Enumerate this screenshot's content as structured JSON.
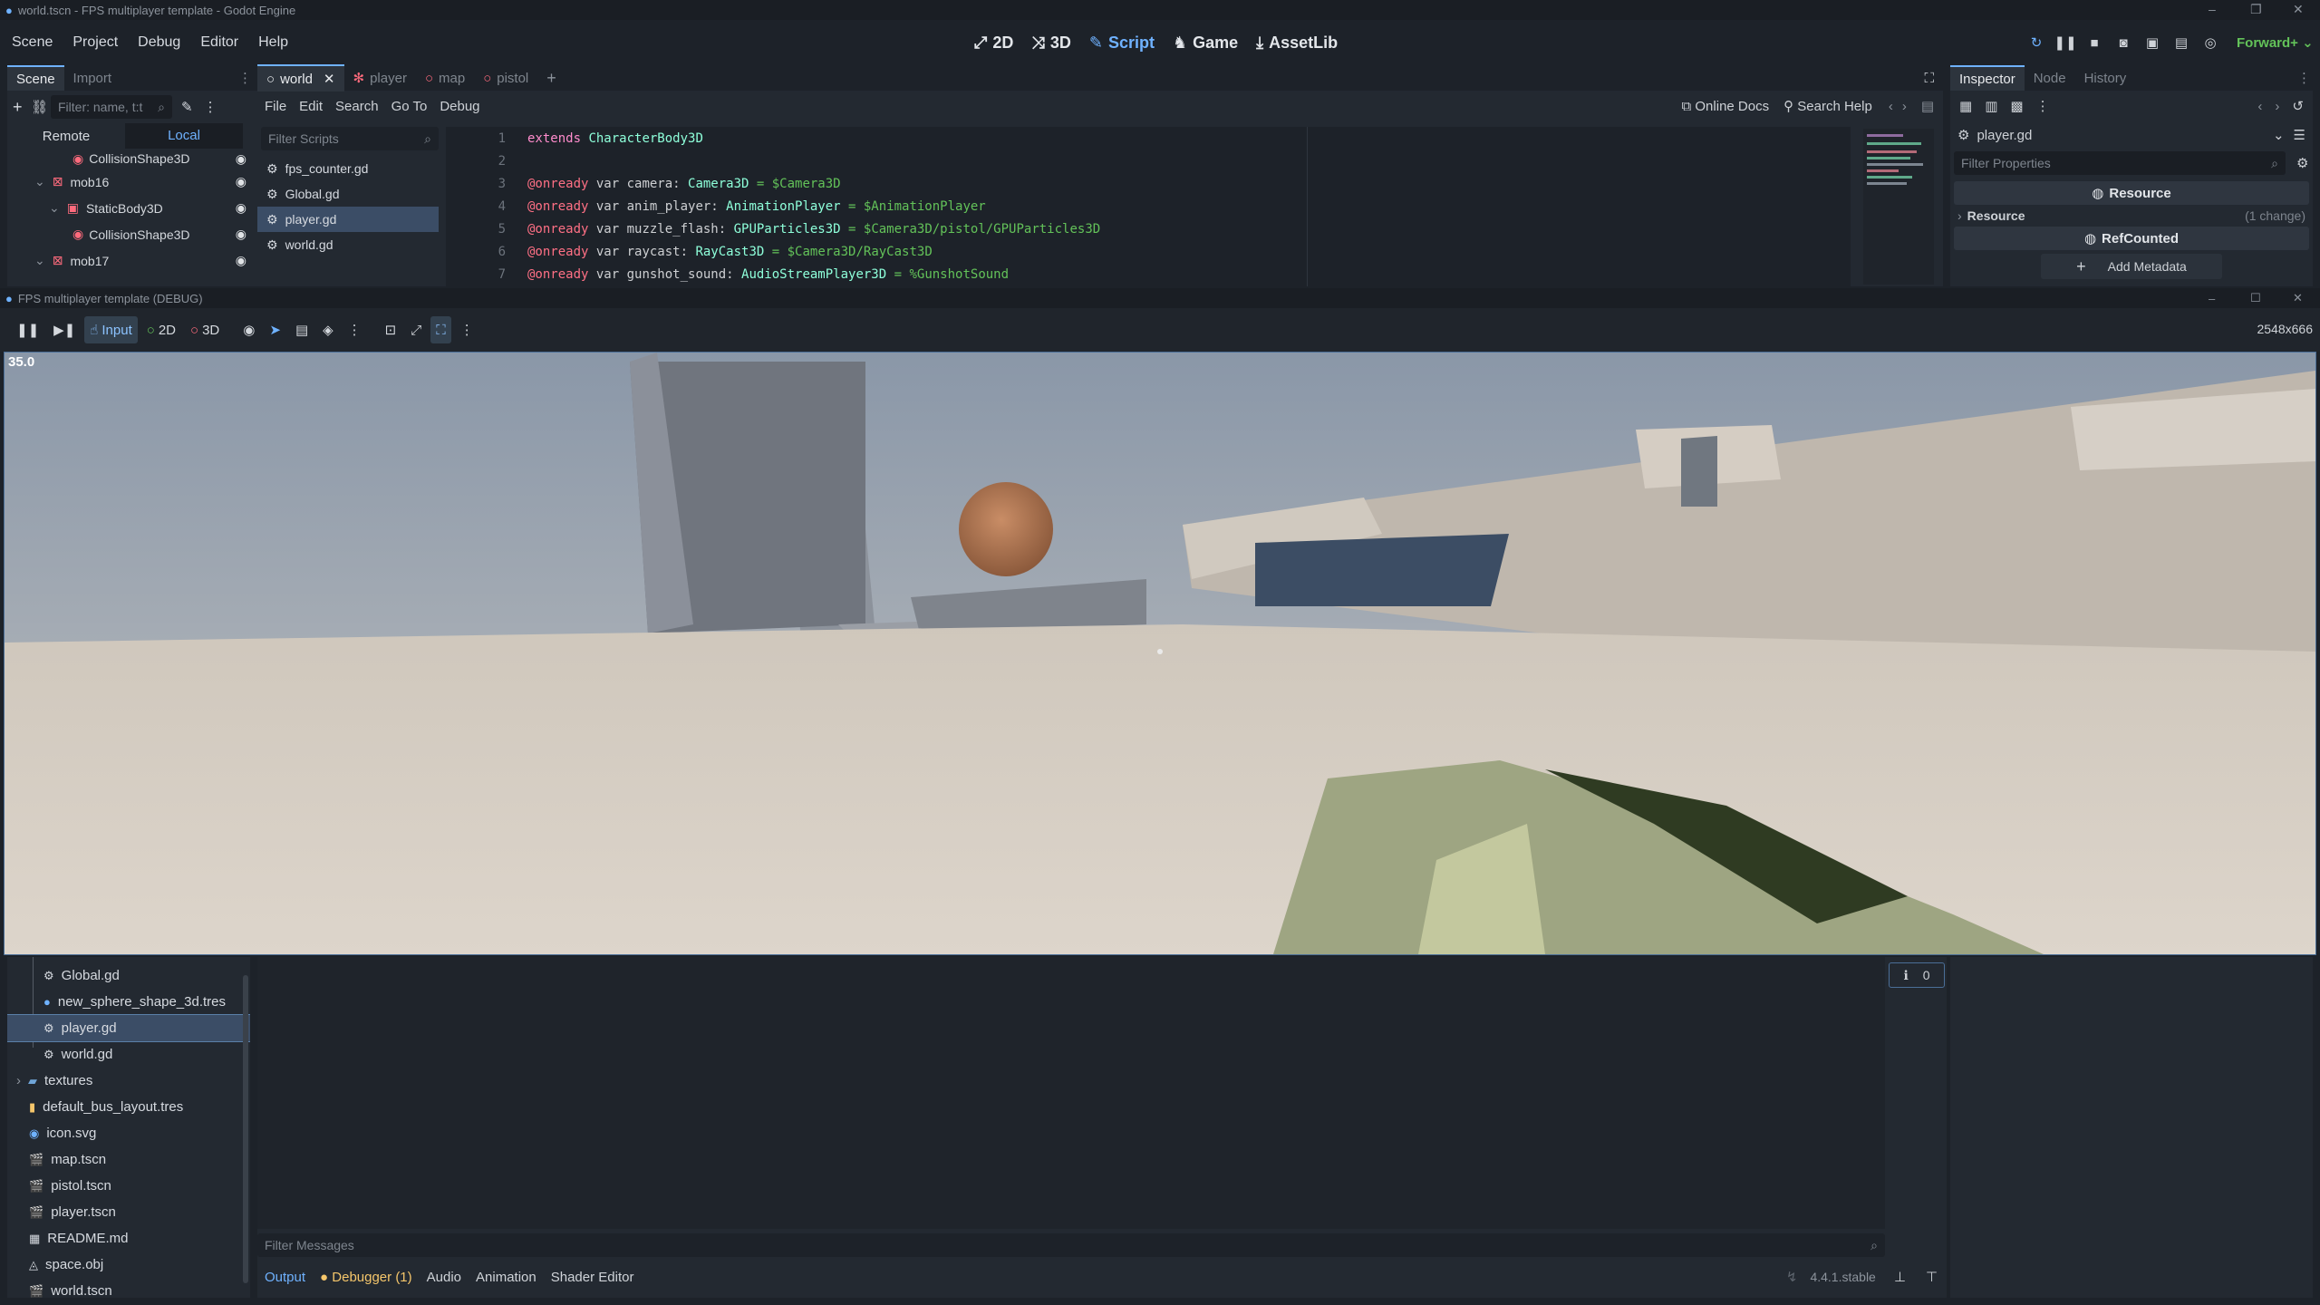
{
  "title_bar": {
    "title": "world.tscn - FPS multiplayer template - Godot Engine"
  },
  "menu": [
    "Scene",
    "Project",
    "Debug",
    "Editor",
    "Help"
  ],
  "workspaces": [
    {
      "label": "2D",
      "active": false
    },
    {
      "label": "3D",
      "active": false
    },
    {
      "label": "Script",
      "active": true
    },
    {
      "label": "Game",
      "active": false
    },
    {
      "label": "AssetLib",
      "active": false
    }
  ],
  "renderer": "Forward+",
  "scene_dock": {
    "tabs": [
      "Scene",
      "Import"
    ],
    "filter_placeholder": "Filter: name, t:t",
    "remote_label": "Remote",
    "local_label": "Local",
    "tree": [
      {
        "label": "CollisionShape3D",
        "indent": 2,
        "icon": "collision-shape-icon"
      },
      {
        "label": "mob16",
        "indent": 1,
        "icon": "node3d-icon",
        "expanded": true
      },
      {
        "label": "StaticBody3D",
        "indent": 2,
        "icon": "static-body-icon",
        "expanded": true
      },
      {
        "label": "CollisionShape3D",
        "indent": 3,
        "icon": "collision-shape-icon"
      },
      {
        "label": "mob17",
        "indent": 1,
        "icon": "node3d-icon",
        "expanded": true
      }
    ]
  },
  "script_editor": {
    "scene_tabs": [
      {
        "label": "world",
        "active": true,
        "icon": "circle-icon"
      },
      {
        "label": "player",
        "active": false,
        "icon": "skeleton-icon"
      },
      {
        "label": "map",
        "active": false,
        "icon": "circle-icon"
      },
      {
        "label": "pistol",
        "active": false,
        "icon": "circle-icon"
      }
    ],
    "menu": [
      "File",
      "Edit",
      "Search",
      "Go To",
      "Debug"
    ],
    "online_docs": "Online Docs",
    "search_help": "Search Help",
    "filter_scripts_placeholder": "Filter Scripts",
    "scripts": [
      {
        "label": "fps_counter.gd",
        "selected": false
      },
      {
        "label": "Global.gd",
        "selected": false
      },
      {
        "label": "player.gd",
        "selected": true
      },
      {
        "label": "world.gd",
        "selected": false
      }
    ],
    "code": [
      {
        "n": "1",
        "a": "extends",
        "b": " ",
        "c": "CharacterBody3D",
        "d": ""
      },
      {
        "n": "2",
        "a": "",
        "b": "",
        "c": "",
        "d": ""
      },
      {
        "n": "3",
        "a": "@onready",
        "b": " var camera: ",
        "c": "Camera3D",
        "d": " = $Camera3D"
      },
      {
        "n": "4",
        "a": "@onready",
        "b": " var anim_player: ",
        "c": "AnimationPlayer",
        "d": " = $AnimationPlayer"
      },
      {
        "n": "5",
        "a": "@onready",
        "b": " var muzzle_flash: ",
        "c": "GPUParticles3D",
        "d": " = $Camera3D/pistol/GPUParticles3D"
      },
      {
        "n": "6",
        "a": "@onready",
        "b": " var raycast: ",
        "c": "RayCast3D",
        "d": " = $Camera3D/RayCast3D"
      },
      {
        "n": "7",
        "a": "@onready",
        "b": " var gunshot_sound: ",
        "c": "AudioStreamPlayer3D",
        "d": " = %GunshotSound"
      }
    ]
  },
  "inspector": {
    "tabs": [
      "Inspector",
      "Node",
      "History"
    ],
    "resource_path": "player.gd",
    "filter_placeholder": "Filter Properties",
    "section_resource": "Resource",
    "row_resource": "Resource",
    "row_resource_changes": "(1 change)",
    "section_refcounted": "RefCounted",
    "add_metadata": "Add Metadata"
  },
  "debug_window": {
    "title": "FPS multiplayer template (DEBUG)",
    "toolbar": [
      {
        "label": "Input",
        "active": true
      },
      {
        "label": "2D",
        "active": false
      },
      {
        "label": "3D",
        "active": false
      }
    ],
    "resolution": "2548x666",
    "fps": "35.0"
  },
  "filesystem": {
    "items": [
      {
        "label": "Global.gd",
        "indent": 2,
        "icon": "gear-icon",
        "selected": false
      },
      {
        "label": "new_sphere_shape_3d.tres",
        "indent": 2,
        "icon": "sphere-shape-icon",
        "selected": false
      },
      {
        "label": "player.gd",
        "indent": 2,
        "icon": "gear-icon",
        "selected": true
      },
      {
        "label": "world.gd",
        "indent": 2,
        "icon": "gear-icon",
        "selected": false
      },
      {
        "label": "textures",
        "indent": 1,
        "icon": "folder-icon",
        "selected": false
      },
      {
        "label": "default_bus_layout.tres",
        "indent": 1,
        "icon": "audio-bus-icon",
        "selected": false
      },
      {
        "label": "icon.svg",
        "indent": 1,
        "icon": "image-icon",
        "selected": false
      },
      {
        "label": "map.tscn",
        "indent": 1,
        "icon": "scene-icon",
        "selected": false
      },
      {
        "label": "pistol.tscn",
        "indent": 1,
        "icon": "scene-icon",
        "selected": false
      },
      {
        "label": "player.tscn",
        "indent": 1,
        "icon": "scene-icon",
        "selected": false
      },
      {
        "label": "README.md",
        "indent": 1,
        "icon": "text-file-icon",
        "selected": false
      },
      {
        "label": "space.obj",
        "indent": 1,
        "icon": "mesh-icon",
        "selected": false
      },
      {
        "label": "world.tscn",
        "indent": 1,
        "icon": "scene-icon",
        "selected": false
      }
    ]
  },
  "output": {
    "message_count": "0",
    "filter_placeholder": "Filter Messages",
    "bottom_tabs": [
      {
        "label": "Output",
        "state": "active"
      },
      {
        "label": "Debugger (1)",
        "state": "warn"
      },
      {
        "label": "Audio",
        "state": "normal"
      },
      {
        "label": "Animation",
        "state": "normal"
      },
      {
        "label": "Shader Editor",
        "state": "normal"
      }
    ],
    "version": "4.4.1.stable"
  },
  "colors": {
    "accent": "#6fb2ff",
    "bg_dark": "#1d2229",
    "panel": "#232931",
    "selection": "#3b4d66",
    "warning": "#f5c66b"
  }
}
